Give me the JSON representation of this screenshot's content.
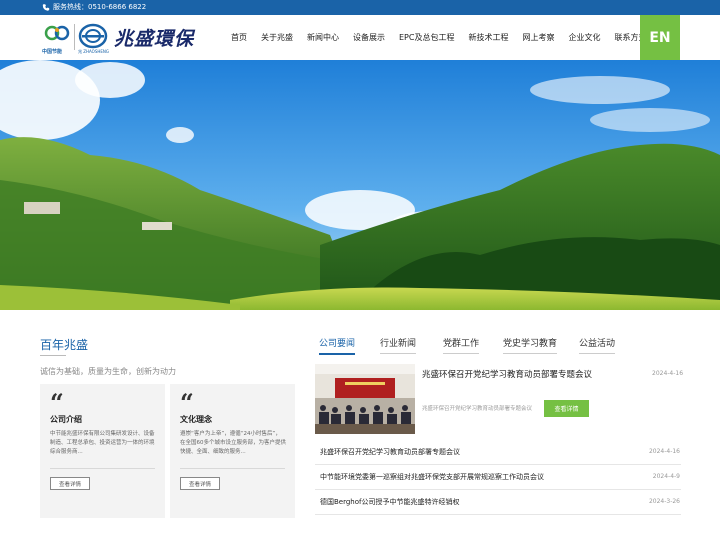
{
  "topbar": {
    "hotline": "服务热线：0510-6866 6822"
  },
  "header": {
    "logo_cn_text": "中国节能",
    "logo_zs_text": "兆 ZHAOSHENG",
    "brand": "兆盛環保",
    "nav": [
      "首页",
      "关于兆盛",
      "新闻中心",
      "设备展示",
      "EPC及总包工程",
      "新技术工程",
      "网上考察",
      "企业文化",
      "联系方式"
    ],
    "lang_button": "EN"
  },
  "about": {
    "title": "百年兆盛",
    "slogan": "诚信为基础，质量为生命，创新为动力",
    "cards": [
      {
        "quote": "“",
        "title": "公司介绍",
        "text": "中节能兆盛环保有限公司集研发设计、设备制造、工程总承包、投资运营为一体的环境综合服务商...",
        "button": "查看详情"
      },
      {
        "quote": "“",
        "title": "文化理念",
        "text": "遵崇“客户为上帝”，遵循“24小时售后”，在全国60多个城市设立服务部，为客户提供快捷、全面、细致的服务...",
        "button": "查看详情"
      }
    ]
  },
  "news": {
    "tabs": [
      "公司要闻",
      "行业新闻",
      "党群工作",
      "党史学习教育",
      "公益活动"
    ],
    "active_tab": 0,
    "featured": {
      "title": "兆盛环保召开党纪学习教育动员部署专题会议",
      "date": "2024-4-16",
      "summary": "兆盛环保召开党纪学习教育动员部署专题会议",
      "button": "查看详情"
    },
    "items": [
      {
        "title": "兆盛环保召开党纪学习教育动员部署专题会议",
        "date": "2024-4-16"
      },
      {
        "title": "中节能环境党委第一巡察组对兆盛环保党支部开展常规巡察工作动员会议",
        "date": "2024-4-9"
      },
      {
        "title": "德国Berghof公司授予中节能兆盛特许经销权",
        "date": "2024-3-26"
      }
    ]
  },
  "colors": {
    "topbar": "#1a63a8",
    "accent_green": "#75c043",
    "brand_blue": "#1a63a8"
  }
}
